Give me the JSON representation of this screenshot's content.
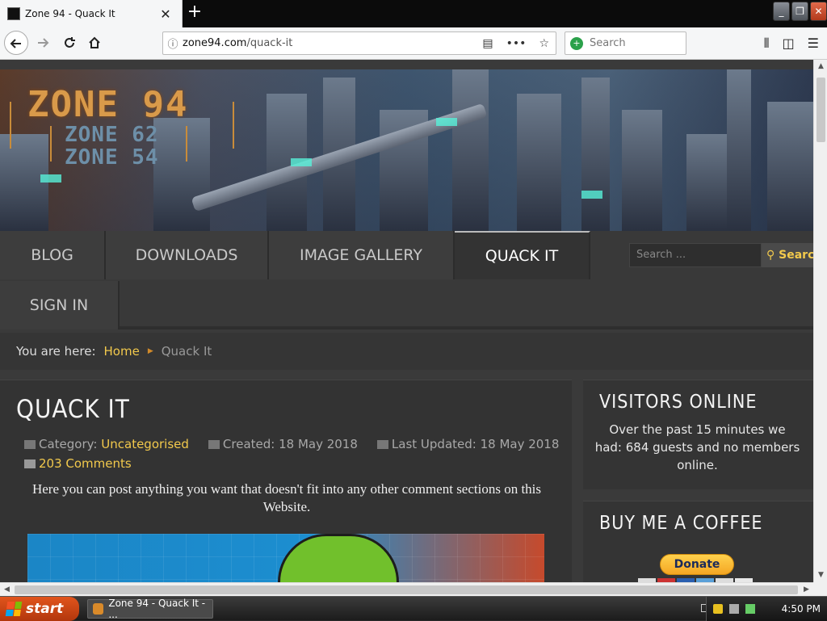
{
  "browser": {
    "tab_title": "Zone 94 - Quack It",
    "tab_close": "✕",
    "new_tab": "+",
    "url_host": "zone94.com",
    "url_path": "/quack-it",
    "search_placeholder": "Search",
    "window_buttons": {
      "minimize": "_",
      "restore": "❐",
      "close": "✕"
    }
  },
  "site": {
    "logo_main": "ZONE 94",
    "logo_sub1": "ZONE 62",
    "logo_sub2": "ZONE 54",
    "menu": [
      {
        "label": "BLOG"
      },
      {
        "label": "DOWNLOADS"
      },
      {
        "label": "IMAGE GALLERY"
      },
      {
        "label": "QUACK IT",
        "active": true
      },
      {
        "label": "SIGN IN"
      }
    ],
    "search_placeholder": "Search ...",
    "search_button": "Search"
  },
  "breadcrumb": {
    "label": "You are here:",
    "home": "Home",
    "current": "Quack It"
  },
  "article": {
    "title": "QUACK IT",
    "category_label": "Category:",
    "category": "Uncategorised",
    "created": "Created: 18 May 2018",
    "updated": "Last Updated: 18 May 2018",
    "comments": "203 Comments",
    "intro": "Here you can post anything you want that doesn't fit into any other comment sections on this Website."
  },
  "sidebar": {
    "visitors_title": "VISITORS ONLINE",
    "visitors_text": "Over the past 15 minutes we had: 684 guests and no members online.",
    "coffee_title": "BUY ME A COFFEE",
    "donate_label": "Donate"
  },
  "taskbar": {
    "start_label": "start",
    "task_label": "Zone 94 - Quack It - ...",
    "clock": "4:50 PM"
  },
  "colors": {
    "accent_link": "#f2c94c",
    "page_bg": "#3a3a3a",
    "start_button": "#d9491a"
  }
}
